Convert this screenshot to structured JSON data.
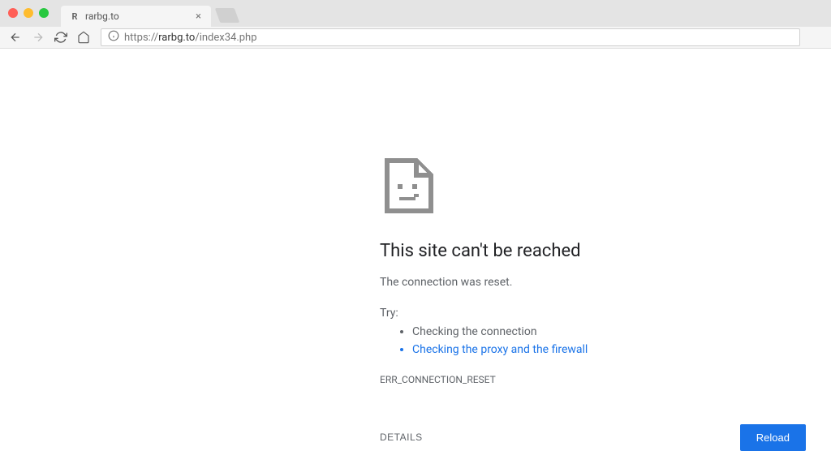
{
  "window": {
    "tab": {
      "title": "rarbg.to",
      "favicon_letter": "R"
    }
  },
  "address": {
    "protocol": "https://",
    "domain": "rarbg.to",
    "path": "/index34.php"
  },
  "error": {
    "title": "This site can't be reached",
    "subtitle": "The connection was reset.",
    "try_label": "Try:",
    "suggestions": {
      "item0": "Checking the connection",
      "item1": "Checking the proxy and the firewall"
    },
    "code": "ERR_CONNECTION_RESET",
    "details_label": "DETAILS",
    "reload_label": "Reload"
  }
}
